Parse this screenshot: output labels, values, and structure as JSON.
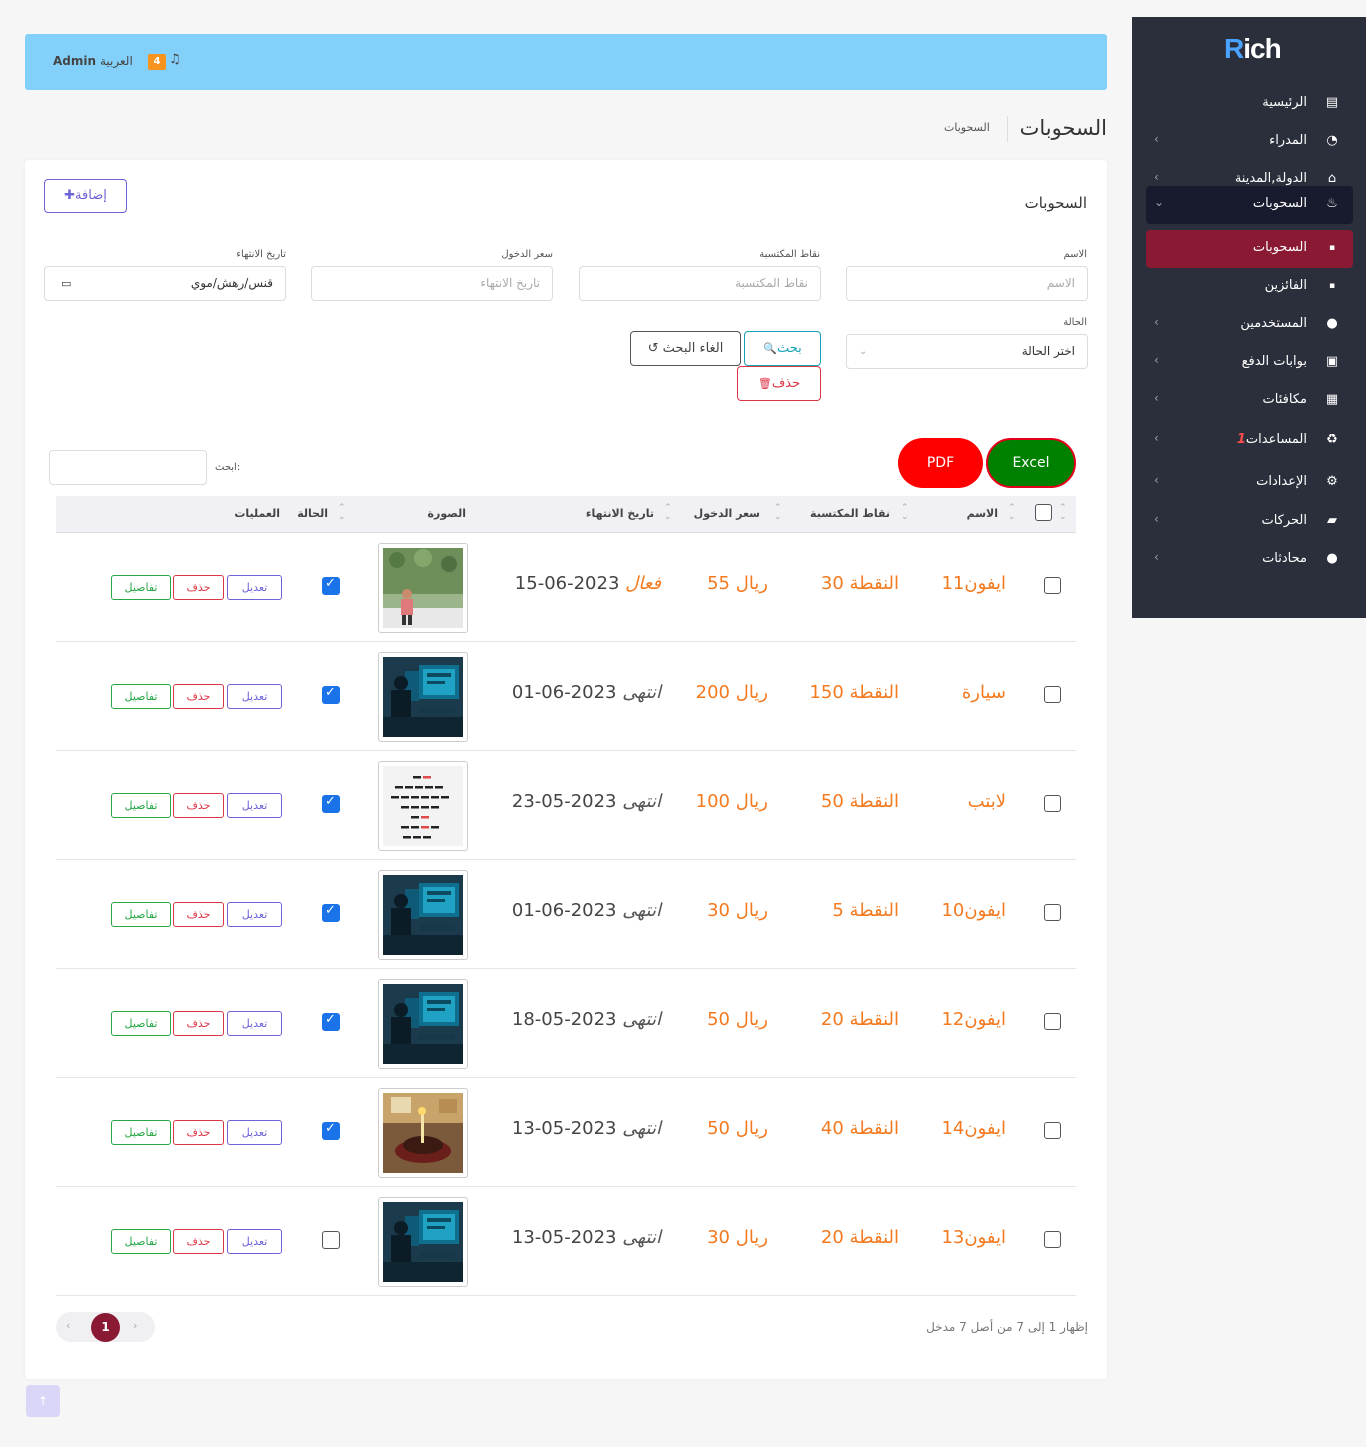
{
  "brand": {
    "logo_r": "R",
    "logo_rest": "ich"
  },
  "sidebar": {
    "items": [
      {
        "label": "الرئيسية",
        "icon": "document-icon",
        "glyph": "▤",
        "has_chevron": false
      },
      {
        "label": "المدراء",
        "icon": "pie-chart-icon",
        "glyph": "◔",
        "has_chevron": true
      },
      {
        "label": "الدولة,المدينة",
        "icon": "home-icon",
        "glyph": "⌂",
        "has_chevron": true
      },
      {
        "label": "السحوبات",
        "icon": "fire-icon",
        "glyph": "♨",
        "has_chevron": true,
        "chevron": "⌄"
      },
      {
        "label": "السحوبات",
        "icon": "file-icon",
        "glyph": "▪"
      },
      {
        "label": "الفائزين",
        "icon": "file-icon",
        "glyph": "▪"
      },
      {
        "label": "المستخدمين",
        "icon": "user-icon",
        "glyph": "●",
        "has_chevron": true
      },
      {
        "label": "بوابات الدفع",
        "icon": "money-icon",
        "glyph": "▣",
        "has_chevron": true
      },
      {
        "label": "مكافئات",
        "icon": "gift-icon",
        "glyph": "▦",
        "has_chevron": true
      },
      {
        "label": "المساعدات",
        "badge": "1",
        "icon": "recycle-icon",
        "glyph": "♻",
        "has_chevron": true
      },
      {
        "label": "الإعدادات",
        "icon": "gear-icon",
        "glyph": "⚙",
        "has_chevron": true
      },
      {
        "label": "الحركات",
        "icon": "truck-icon",
        "glyph": "▰",
        "has_chevron": true
      },
      {
        "label": "محادثات",
        "icon": "user-icon",
        "glyph": "●",
        "has_chevron": true
      }
    ],
    "chevron": "‹"
  },
  "topbar": {
    "user": "Admin",
    "language": "العربية",
    "notifications": "4",
    "bell": "🔔"
  },
  "page": {
    "title": "السحوبات",
    "breadcrumb": "السحوبات"
  },
  "card": {
    "title": "السحوبات",
    "add_button": "إضافة",
    "add_icon": "✚"
  },
  "filters": {
    "name": {
      "label": "الاسم",
      "placeholder": "الاسم"
    },
    "points": {
      "label": "نقاط المكتسبة",
      "placeholder": "نقاط المكتسبة"
    },
    "price": {
      "label": "سعر الدخول",
      "placeholder": "تاريخ الانتهاء"
    },
    "end_date": {
      "label": "تاريخ الانتهاء",
      "value": "قنس/رهش/موي",
      "icon": "▭"
    },
    "status": {
      "label": "الحالة",
      "value": "اختر الحالة",
      "arrow": "⌄"
    },
    "search_button": "بحث",
    "search_icon": "🔍",
    "cancel_button": "الغاء البحث",
    "cancel_icon": "↺",
    "delete_button": "حذف",
    "delete_icon": "🗑"
  },
  "export": {
    "excel": "Excel",
    "pdf": "PDF"
  },
  "table_search": {
    "label": "ابحث:"
  },
  "table": {
    "columns": [
      "الاسم",
      "نقاط المكتسبة",
      "سعر الدخول",
      "تاريخ الانتهاء",
      "الصورة",
      "الحالة",
      "العمليات"
    ],
    "sort_glyph": "⌃⌄",
    "actions": {
      "edit": "تعديل",
      "delete": "حذف",
      "details": "تفاصيل"
    },
    "rows": [
      {
        "name": "ايفون11",
        "points": "30 النقطة",
        "price": "55 ريال",
        "date": "2023-06-15",
        "state": "فعال",
        "active": true,
        "status": true,
        "thumb": "portrait"
      },
      {
        "name": "سيارة",
        "points": "150 النقطة",
        "price": "200 ريال",
        "date": "2023-06-01",
        "state": "انتهى",
        "active": false,
        "status": true,
        "thumb": "desk"
      },
      {
        "name": "لابتب",
        "points": "50 النقطة",
        "price": "100 ريال",
        "date": "2023-05-23",
        "state": "انتهى",
        "active": false,
        "status": true,
        "thumb": "chart"
      },
      {
        "name": "ايفون10",
        "points": "5 النقطة",
        "price": "30 ريال",
        "date": "2023-06-01",
        "state": "انتهى",
        "active": false,
        "status": true,
        "thumb": "desk"
      },
      {
        "name": "ايفون12",
        "points": "20 النقطة",
        "price": "50 ريال",
        "date": "2023-05-18",
        "state": "انتهى",
        "active": false,
        "status": true,
        "thumb": "desk"
      },
      {
        "name": "ايفون14",
        "points": "40 النقطة",
        "price": "50 ريال",
        "date": "2023-05-13",
        "state": "انتهى",
        "active": false,
        "status": true,
        "thumb": "cake"
      },
      {
        "name": "ايفون13",
        "points": "20 النقطة",
        "price": "30 ريال",
        "date": "2023-05-13",
        "state": "انتهى",
        "active": false,
        "status": false,
        "thumb": "desk"
      }
    ]
  },
  "pagination": {
    "current": "1",
    "prev": "‹",
    "next": "›",
    "info": "إظهار 1 إلى 7 من أصل 7 مدخل"
  },
  "scroll_top": "↑",
  "colors": {
    "accent": "#8a1933",
    "sidebar": "#2b2f3b",
    "value_orange": "#f47a20",
    "topbar": "#83d1fb"
  }
}
